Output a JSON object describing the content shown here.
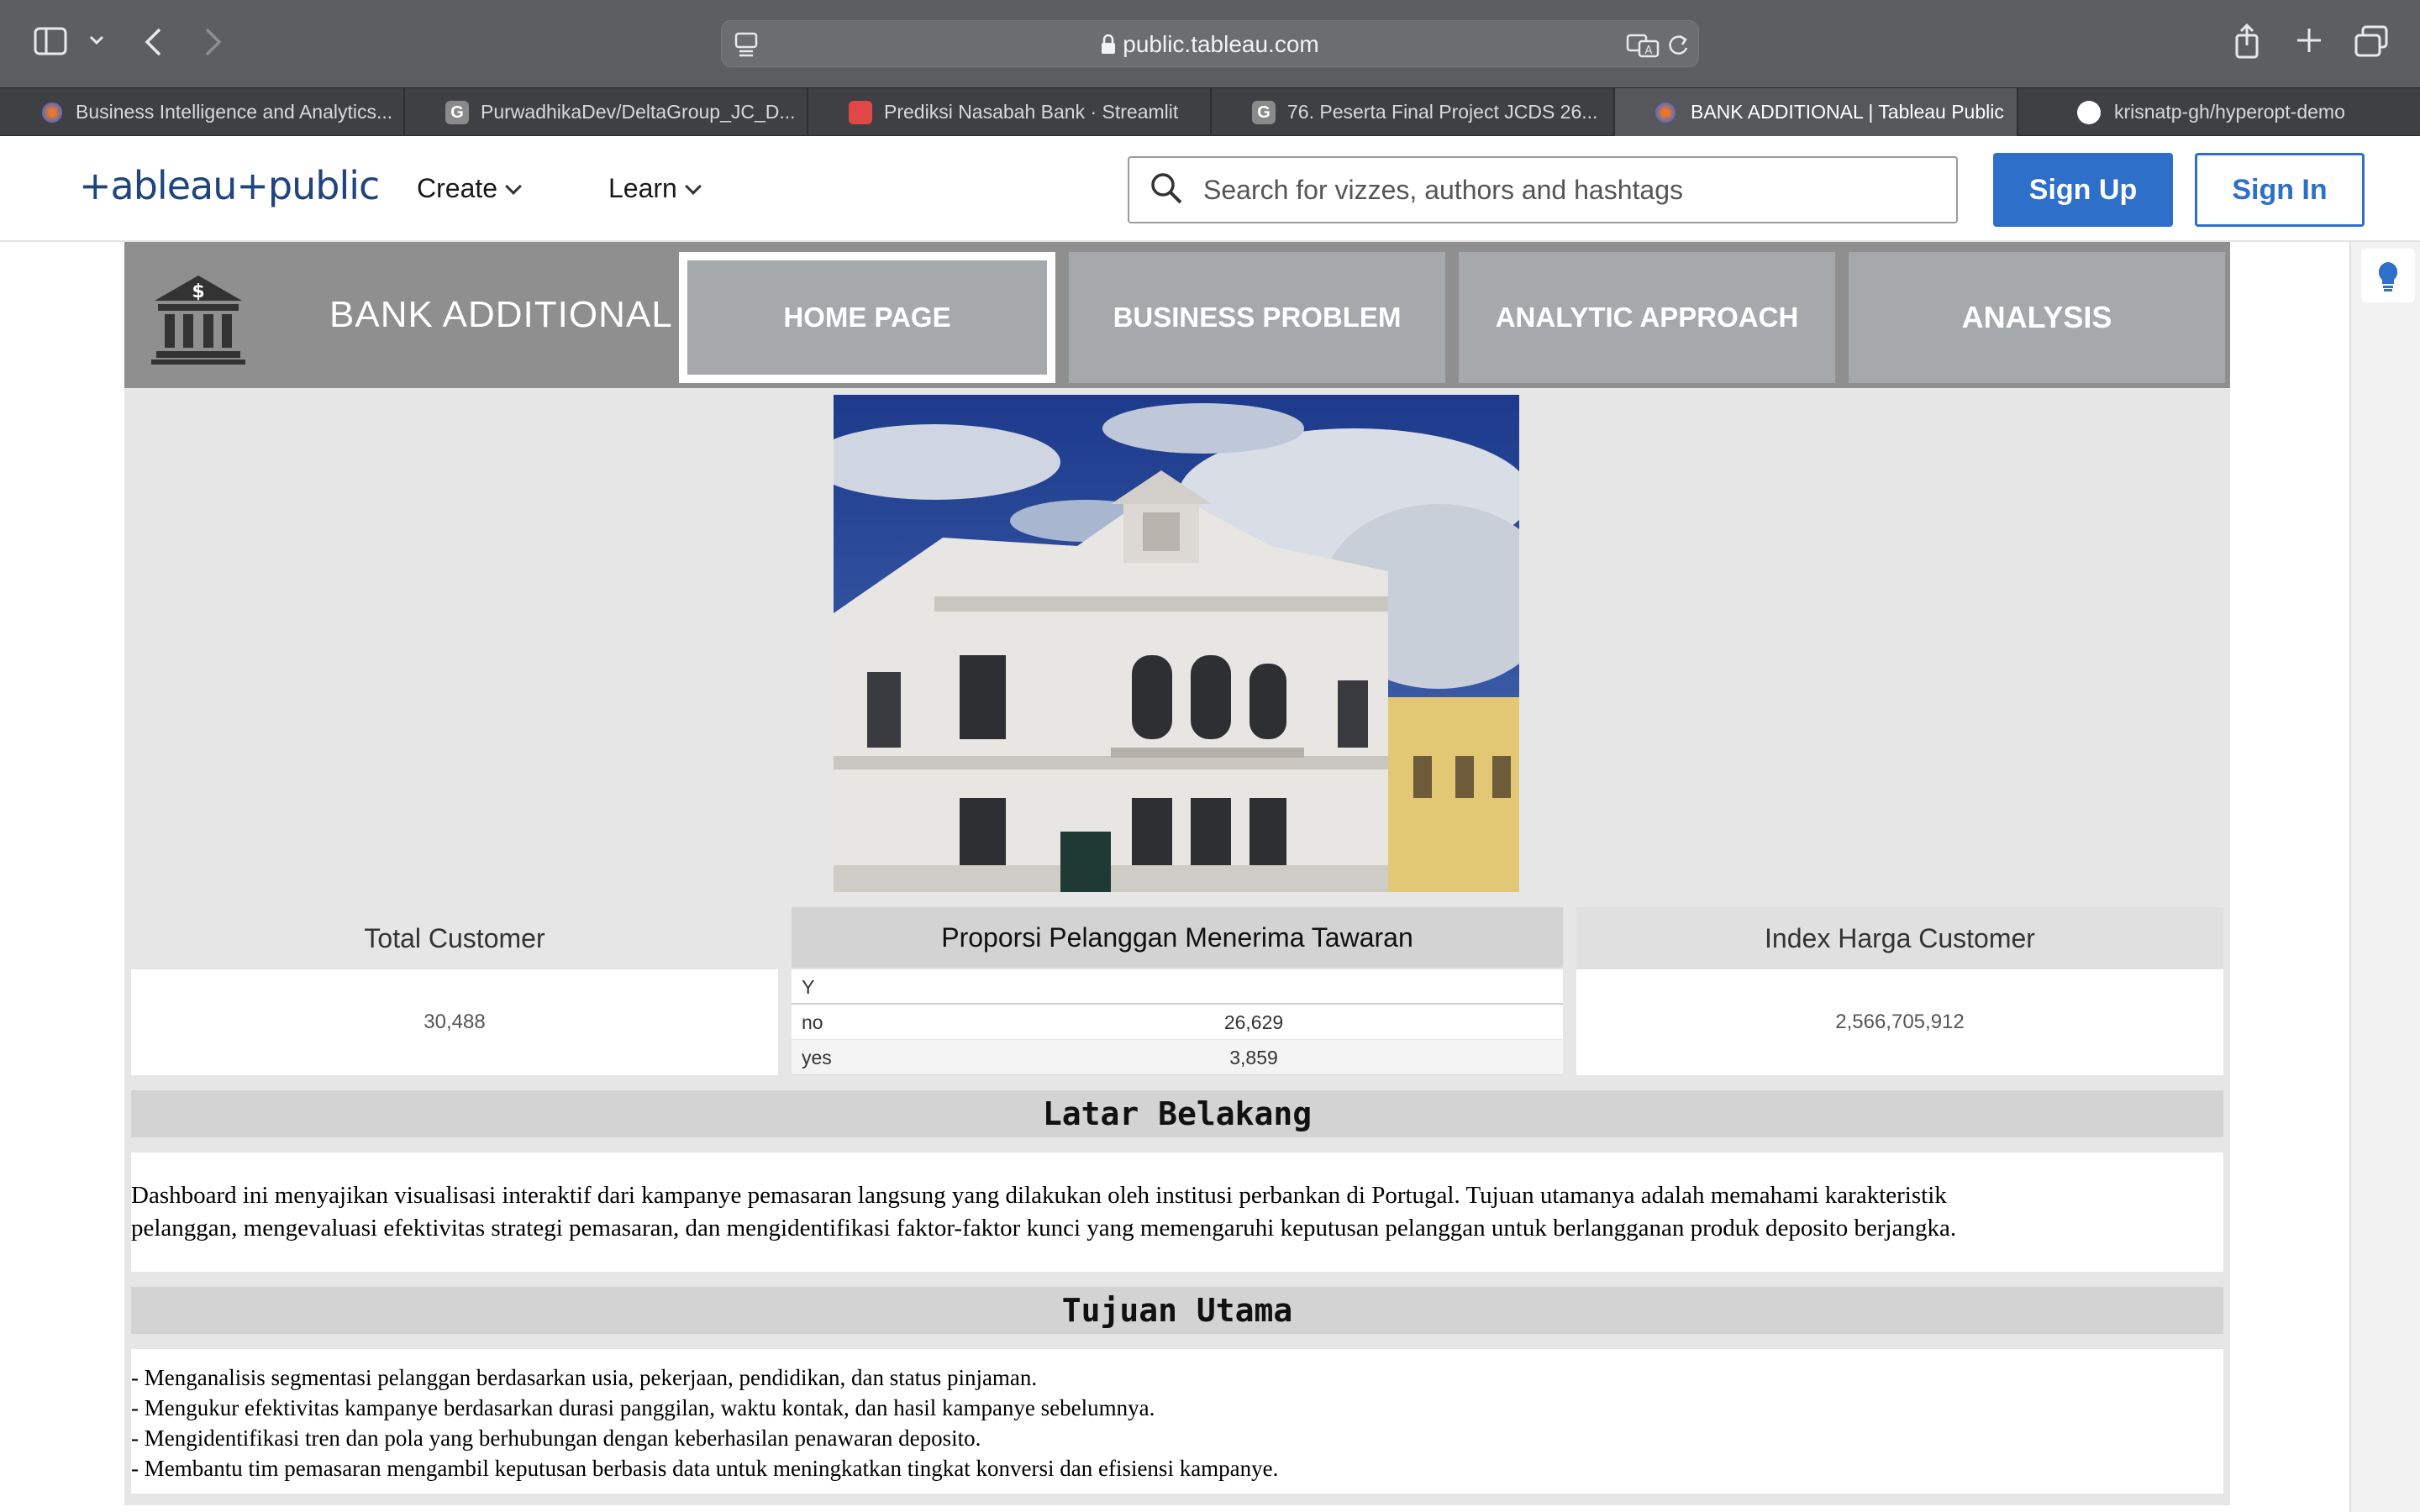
{
  "browser": {
    "url": "public.tableau.com",
    "tabs": [
      {
        "label": "Business Intelligence and Analytics...",
        "active": false,
        "favicon_color": "#e8762d"
      },
      {
        "label": "PurwadhikaDev/DeltaGroup_JC_D...",
        "active": false,
        "favicon_color": "#8a8a8a"
      },
      {
        "label": "Prediksi Nasabah Bank · Streamlit",
        "active": false,
        "favicon_color": "#e04848"
      },
      {
        "label": "76. Peserta Final Project JCDS 26...",
        "active": false,
        "favicon_color": "#8a8a8a"
      },
      {
        "label": "BANK ADDITIONAL | Tableau Public",
        "active": true,
        "favicon_color": "#e8762d"
      },
      {
        "label": "krisnatp-gh/hyperopt-demo",
        "active": false,
        "favicon_color": "#ffffff"
      }
    ]
  },
  "site_header": {
    "logo_text": "+ableau+public",
    "nav": [
      "Create",
      "Learn"
    ],
    "search_placeholder": "Search for vizzes, authors and hashtags",
    "signup_label": "Sign Up",
    "signin_label": "Sign In"
  },
  "dashboard": {
    "title": "BANK ADDITIONAL",
    "nav_buttons": [
      {
        "label": "HOME PAGE",
        "active": true
      },
      {
        "label": "BUSINESS PROBLEM",
        "active": false
      },
      {
        "label": "ANALYTIC APPROACH",
        "active": false
      },
      {
        "label": "ANALYSIS",
        "active": false
      }
    ],
    "kpis": {
      "total_customer": {
        "title": "Total Customer",
        "value": "30,488"
      },
      "proporsi": {
        "title": "Proporsi Pelanggan Menerima Tawaran",
        "header": "Y",
        "rows": [
          {
            "label": "no",
            "value": "26,629"
          },
          {
            "label": "yes",
            "value": "3,859"
          }
        ]
      },
      "index_harga": {
        "title": "Index Harga Customer",
        "value": "2,566,705,912"
      }
    },
    "latar_belakang": {
      "title": "Latar Belakang",
      "text_line1": "Dashboard ini menyajikan visualisasi interaktif dari kampanye pemasaran langsung yang dilakukan oleh institusi perbankan di Portugal. Tujuan utamanya adalah memahami karakteristik",
      "text_line2": "pelanggan, mengevaluasi efektivitas strategi pemasaran, dan mengidentifikasi faktor-faktor kunci yang memengaruhi keputusan pelanggan untuk berlangganan produk deposito berjangka."
    },
    "tujuan_utama": {
      "title": "Tujuan Utama",
      "items": [
        "- Menganalisis segmentasi pelanggan berdasarkan usia, pekerjaan, pendidikan, dan status pinjaman.",
        "- Mengukur efektivitas kampanye berdasarkan durasi panggilan, waktu kontak, dan hasil kampanye sebelumnya.",
        "- Mengidentifikasi tren dan pola yang berhubungan dengan keberhasilan penawaran deposito.",
        "- Membantu tim pemasaran mengambil keputusan berbasis data untuk meningkatkan tingkat konversi dan efisiensi kampanye."
      ]
    }
  }
}
